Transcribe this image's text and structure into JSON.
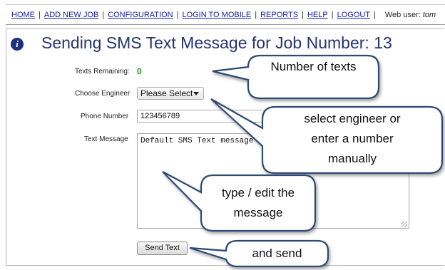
{
  "nav": {
    "links": [
      "HOME",
      "ADD NEW JOB",
      "CONFIGURATION",
      "LOGIN TO MOBILE",
      "REPORTS",
      "HELP",
      "LOGOUT"
    ],
    "web_user_label": "Web user:",
    "web_user_name": "tom"
  },
  "page": {
    "info_icon_glyph": "i",
    "title": "Sending SMS Text Message for Job Number: 13"
  },
  "form": {
    "texts_remaining_label": "Texts Remaining:",
    "texts_remaining_value": "0",
    "engineer_label": "Choose Engineer",
    "engineer_selected": "Please Select",
    "phone_label": "Phone Number",
    "phone_value": "123456789",
    "message_label": "Text Message",
    "message_value": "Default SMS Text message",
    "send_button": "Send Text"
  },
  "callouts": {
    "number_of_texts": "Number of texts",
    "select_engineer_1": "select engineer or",
    "select_engineer_2": "enter a number",
    "select_engineer_3": "manually",
    "type_edit_1": "type / edit the",
    "type_edit_2": "message",
    "and_send": "and send"
  },
  "colors": {
    "title": "#23346e",
    "link": "#1a1aa6",
    "callout_border": "#2e4a72",
    "texts_remaining_value": "#2a8a2a"
  }
}
